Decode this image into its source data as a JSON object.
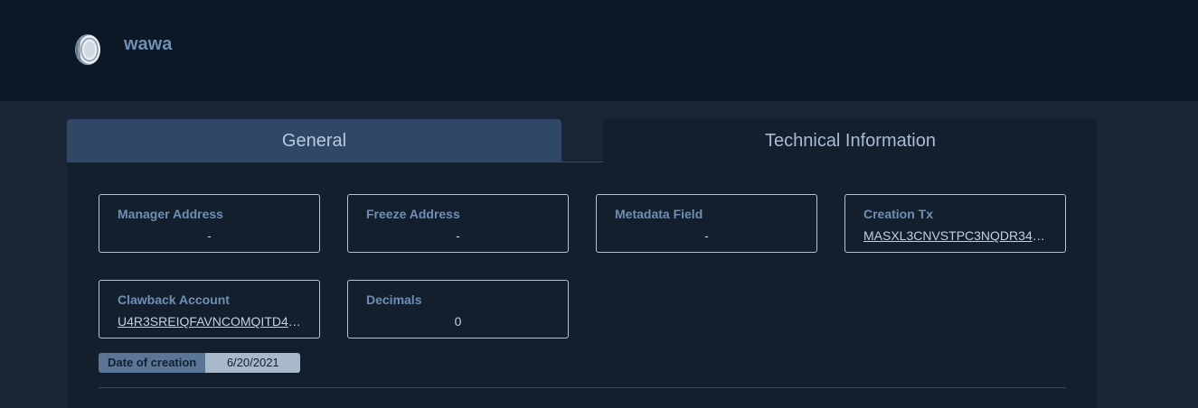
{
  "header": {
    "asset_name": "wawa",
    "icon": "coin-icon"
  },
  "tabs": [
    {
      "label": "General",
      "active": true
    },
    {
      "label": "Technical Information",
      "active": false
    }
  ],
  "fields": {
    "manager_address": {
      "label": "Manager Address",
      "value": "-"
    },
    "freeze_address": {
      "label": "Freeze Address",
      "value": "-"
    },
    "metadata_field": {
      "label": "Metadata Field",
      "value": "-"
    },
    "creation_tx": {
      "label": "Creation Tx",
      "value": "MASXL3CNVSTPC3NQDR347..."
    },
    "clawback_account": {
      "label": "Clawback Account",
      "value": "U4R3SREIQFAVNCOMQITD4R..."
    },
    "decimals": {
      "label": "Decimals",
      "value": "0"
    }
  },
  "creation_date": {
    "label": "Date of creation",
    "value": "6/20/2021"
  },
  "colors": {
    "header_bg": "#0c1826",
    "page_bg": "#1a2636",
    "panel_bg": "#131f2c",
    "active_tab_bg": "#2f4865",
    "label_color": "#6f8fb5"
  }
}
